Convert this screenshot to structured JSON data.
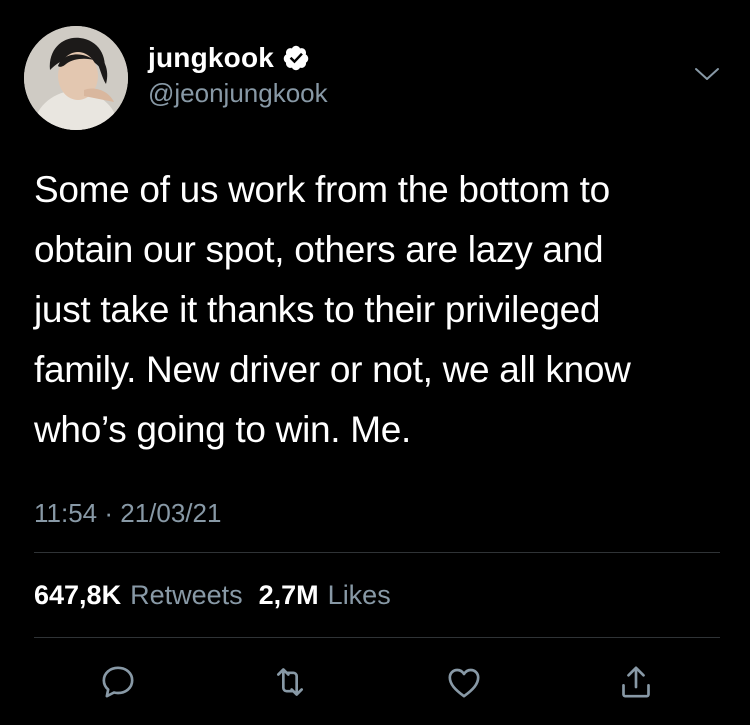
{
  "user": {
    "display_name": "jungkook",
    "handle": "@jeonjungkook",
    "verified": true
  },
  "tweet": {
    "lines": [
      "Some of us work from the bottom to",
      "obtain our spot, others are lazy and",
      "just take it thanks to their privileged",
      "family. New driver or not, we all know",
      "who’s going to win. Me."
    ],
    "timestamp": "11:54 · 21/03/21"
  },
  "stats": {
    "retweets_count": "647,8K",
    "retweets_label": "Retweets",
    "likes_count": "2,7M",
    "likes_label": "Likes"
  },
  "actions": {
    "reply_icon": "reply-icon",
    "retweet_icon": "retweet-icon",
    "like_icon": "heart-icon",
    "share_icon": "share-icon"
  },
  "colors": {
    "background": "#000000",
    "text": "#ffffff",
    "secondary_text": "#8899a6",
    "verified_badge": "#ffffff",
    "divider": "#2f3336"
  }
}
